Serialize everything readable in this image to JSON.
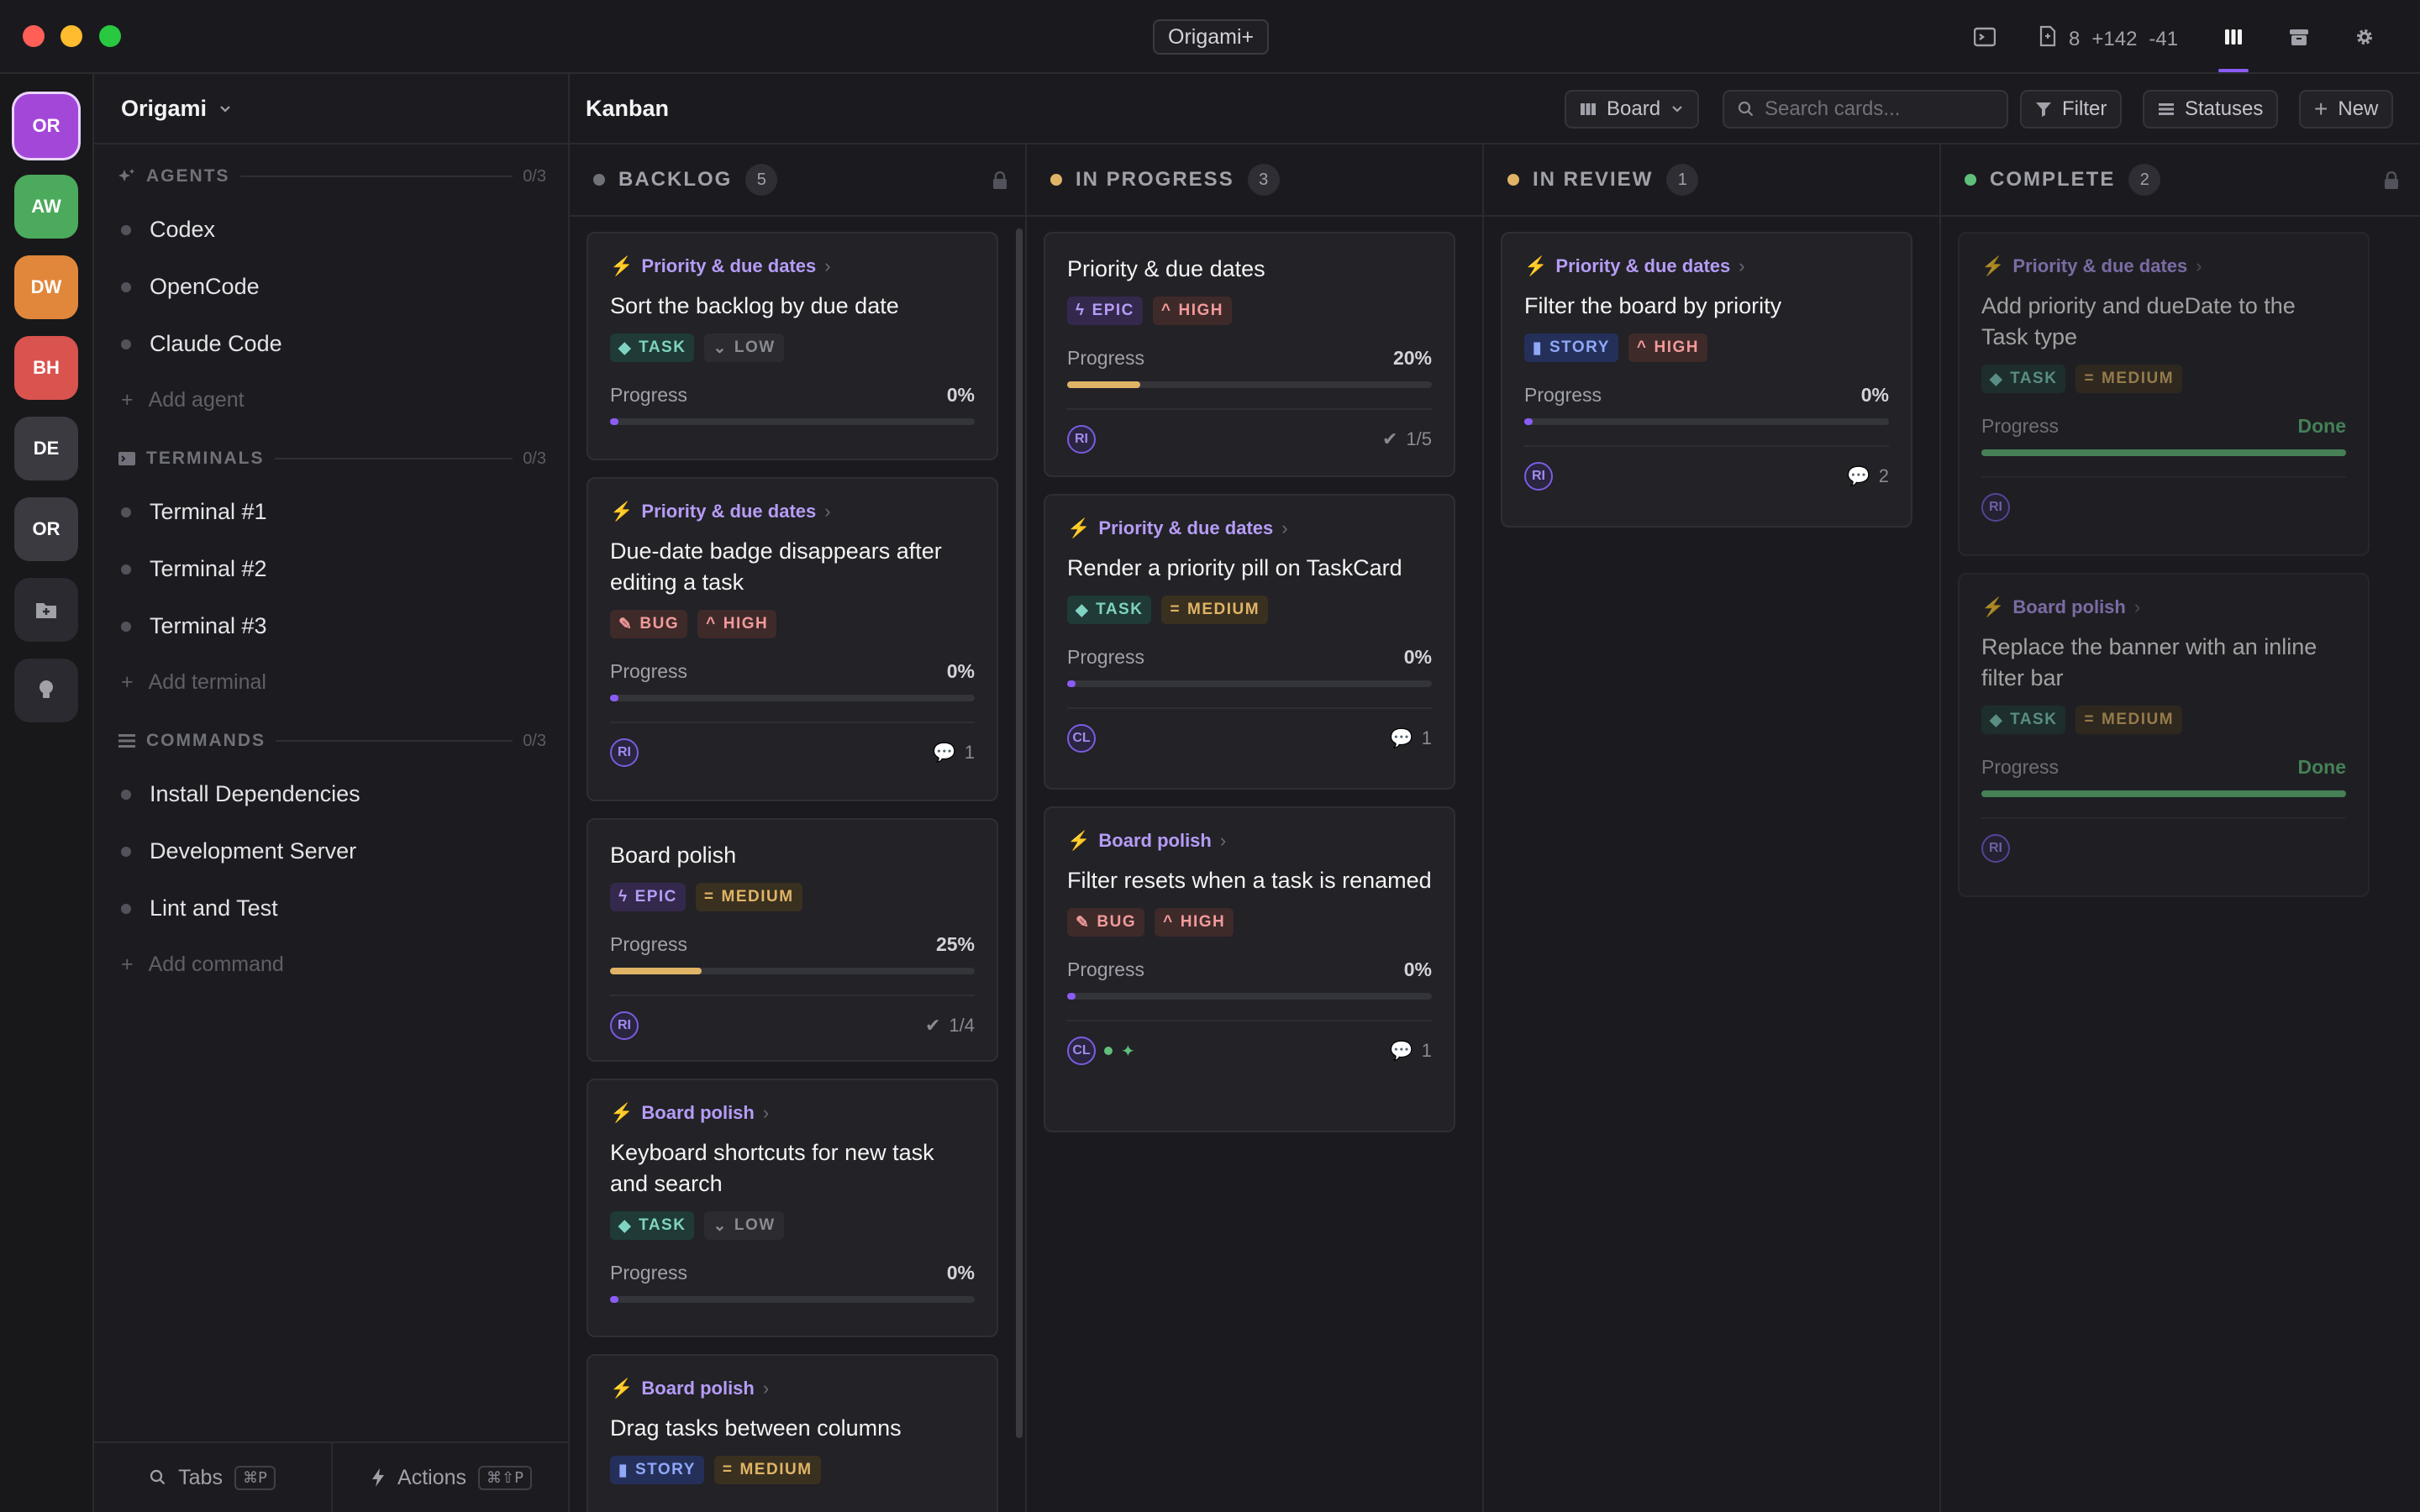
{
  "window": {
    "title": "Origami+",
    "diff": {
      "files": "8",
      "added": "+142",
      "removed": "-41"
    }
  },
  "rail": {
    "workspaces": [
      {
        "initials": "OR",
        "color": "#a347d9"
      },
      {
        "initials": "AW",
        "color": "#4caa5c"
      },
      {
        "initials": "DW",
        "color": "#e0873c"
      },
      {
        "initials": "BH",
        "color": "#d9534f"
      },
      {
        "initials": "DE",
        "color": "#3a3a40"
      },
      {
        "initials": "OR",
        "color": "#3a3a40"
      }
    ]
  },
  "sidebar": {
    "project": "Origami",
    "agents": {
      "title": "AGENTS",
      "count": "0/3",
      "items": [
        "Codex",
        "OpenCode",
        "Claude Code"
      ],
      "add": "Add agent"
    },
    "terminals": {
      "title": "TERMINALS",
      "count": "0/3",
      "items": [
        "Terminal #1",
        "Terminal #2",
        "Terminal #3"
      ],
      "add": "Add terminal"
    },
    "commands": {
      "title": "COMMANDS",
      "count": "0/3",
      "items": [
        "Install Dependencies",
        "Development Server",
        "Lint and Test"
      ],
      "add": "Add command"
    },
    "footer": {
      "tabs": "Tabs",
      "tabs_kbd": "⌘P",
      "actions": "Actions",
      "actions_kbd": "⌘⇧P"
    }
  },
  "main": {
    "title": "Kanban",
    "view": "Board",
    "search_placeholder": "Search cards...",
    "filter": "Filter",
    "statuses": "Statuses",
    "new": "New",
    "progress_label": "Progress",
    "columns": [
      {
        "name": "BACKLOG",
        "count": "5",
        "color": "#71717a",
        "cards": [
          {
            "epic": "Priority & due dates",
            "title": "Sort the backlog by due date",
            "type": "TASK",
            "priority": "LOW",
            "progress": "0%"
          },
          {
            "epic": "Priority & due dates",
            "title": "Due-date badge disappears after editing a task",
            "type": "BUG",
            "priority": "HIGH",
            "progress": "0%",
            "assignee": "RI",
            "comments": "1"
          },
          {
            "title": "Board polish",
            "type": "EPIC",
            "priority": "MEDIUM",
            "progress": "25%",
            "assignee": "RI",
            "subtasks": "1/4"
          },
          {
            "epic": "Board polish",
            "title": "Keyboard shortcuts for new task and search",
            "type": "TASK",
            "priority": "LOW",
            "progress": "0%"
          },
          {
            "epic": "Board polish",
            "title": "Drag tasks between columns",
            "type": "STORY",
            "priority": "MEDIUM"
          }
        ]
      },
      {
        "name": "IN PROGRESS",
        "count": "3",
        "color": "#e0b466",
        "cards": [
          {
            "title": "Priority & due dates",
            "type": "EPIC",
            "priority": "HIGH",
            "progress": "20%",
            "assignee": "RI",
            "subtasks": "1/5"
          },
          {
            "epic": "Priority & due dates",
            "title": "Render a priority pill on TaskCard",
            "type": "TASK",
            "priority": "MEDIUM",
            "progress": "0%",
            "assignee": "CL",
            "comments": "1"
          },
          {
            "epic": "Board polish",
            "title": "Filter resets when a task is renamed",
            "type": "BUG",
            "priority": "HIGH",
            "progress": "0%",
            "assignee": "CL",
            "comments": "1"
          }
        ]
      },
      {
        "name": "IN REVIEW",
        "count": "1",
        "color": "#e0b466",
        "cards": [
          {
            "epic": "Priority & due dates",
            "title": "Filter the board by priority",
            "type": "STORY",
            "priority": "HIGH",
            "progress": "0%",
            "assignee": "RI",
            "comments": "2"
          }
        ]
      },
      {
        "name": "COMPLETE",
        "count": "2",
        "color": "#5fbf7a",
        "cards": [
          {
            "epic": "Priority & due dates",
            "title": "Add priority and dueDate to the Task type",
            "type": "TASK",
            "priority": "MEDIUM",
            "progress": "Done",
            "assignee": "RI"
          },
          {
            "epic": "Board polish",
            "title": "Replace the banner with an inline filter bar",
            "type": "TASK",
            "priority": "MEDIUM",
            "progress": "Done",
            "assignee": "RI"
          }
        ]
      }
    ]
  }
}
